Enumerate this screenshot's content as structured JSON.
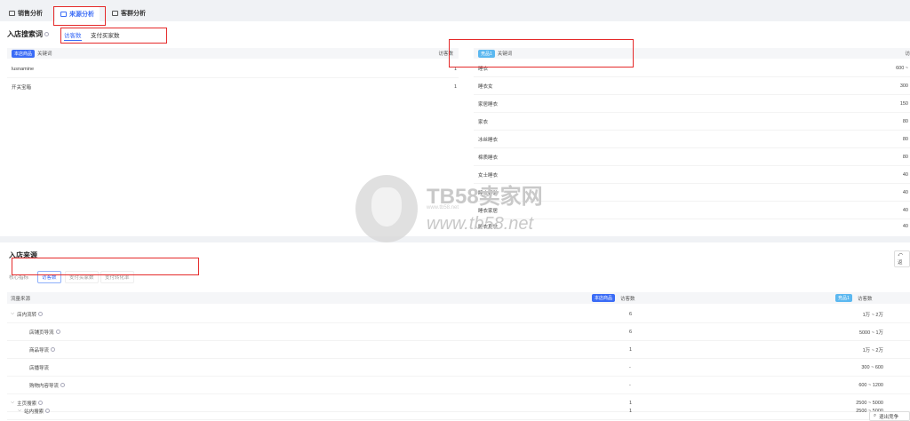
{
  "tabs": [
    {
      "label": "销售分析",
      "icon": "cart-icon"
    },
    {
      "label": "来源分析",
      "icon": "source-icon",
      "active": true
    },
    {
      "label": "客群分析",
      "icon": "people-icon"
    }
  ],
  "search": {
    "title": "入店搜索词",
    "subtabs": [
      "访客数",
      "支付买家数"
    ],
    "left_badge": "本店商品",
    "left_col1": "关键词",
    "left_col2": "访客数",
    "left_rows": [
      {
        "keyword": "lusnamine",
        "value": "1"
      },
      {
        "keyword": "开关宝箱",
        "value": "1"
      }
    ],
    "right_badge": "竞品1",
    "right_col1": "关键词",
    "right_col2": "访",
    "right_rows": [
      {
        "keyword": "睡衣",
        "value": "600 ~"
      },
      {
        "keyword": "睡衣女",
        "value": "300"
      },
      {
        "keyword": "家居睡衣",
        "value": "150"
      },
      {
        "keyword": "家衣",
        "value": "80"
      },
      {
        "keyword": "冰丝睡衣",
        "value": "80"
      },
      {
        "keyword": "棉质睡衣",
        "value": "80"
      },
      {
        "keyword": "女士睡衣",
        "value": "40"
      },
      {
        "keyword": "睡衣套装",
        "value": "40"
      },
      {
        "keyword": "睡衣家居",
        "value": "40"
      },
      {
        "keyword": "睡衣夏季",
        "value": "40"
      }
    ]
  },
  "source": {
    "title": "入店来源",
    "metric_label": "核心指标",
    "pills": [
      "访客数",
      "支付买家数",
      "支付转化率"
    ],
    "top_right_btn": "返",
    "col_source": "流量来源",
    "mid_badge": "本店商品",
    "mid_col": "访客数",
    "right_badge": "竞品1",
    "right_col": "访客数",
    "rows": [
      {
        "name": "店内流转",
        "level": 0,
        "expand": true,
        "help": true,
        "own": "6",
        "comp": "1万 ~ 2万"
      },
      {
        "name": "店铺页导流",
        "level": 1,
        "help": true,
        "own": "6",
        "comp": "5000 ~ 1万"
      },
      {
        "name": "商品导流",
        "level": 1,
        "help": true,
        "own": "1",
        "comp": "1万 ~ 2万"
      },
      {
        "name": "店播导流",
        "level": 1,
        "help": false,
        "own": "-",
        "comp": "300 ~ 600"
      },
      {
        "name": "购物内容导流",
        "level": 1,
        "help": true,
        "own": "-",
        "comp": "600 ~ 1200"
      },
      {
        "name": "主页搜索",
        "level": 0,
        "expand": true,
        "help": true,
        "own": "1",
        "comp": "2500 ~ 5000"
      },
      {
        "name": "站内搜索",
        "level": 1,
        "expand": true,
        "help": true,
        "own": "1",
        "comp": "2500 ~ 5000"
      }
    ]
  },
  "watermark": {
    "brand": "TB58卖家网",
    "small": "www.tb58.net",
    "url": "www.tb58.net"
  },
  "float_button": "退出竞争",
  "colors": {
    "accent": "#3b6cf6",
    "highlight": "#e52a2a",
    "badge_cyan": "#5cb8f0"
  }
}
